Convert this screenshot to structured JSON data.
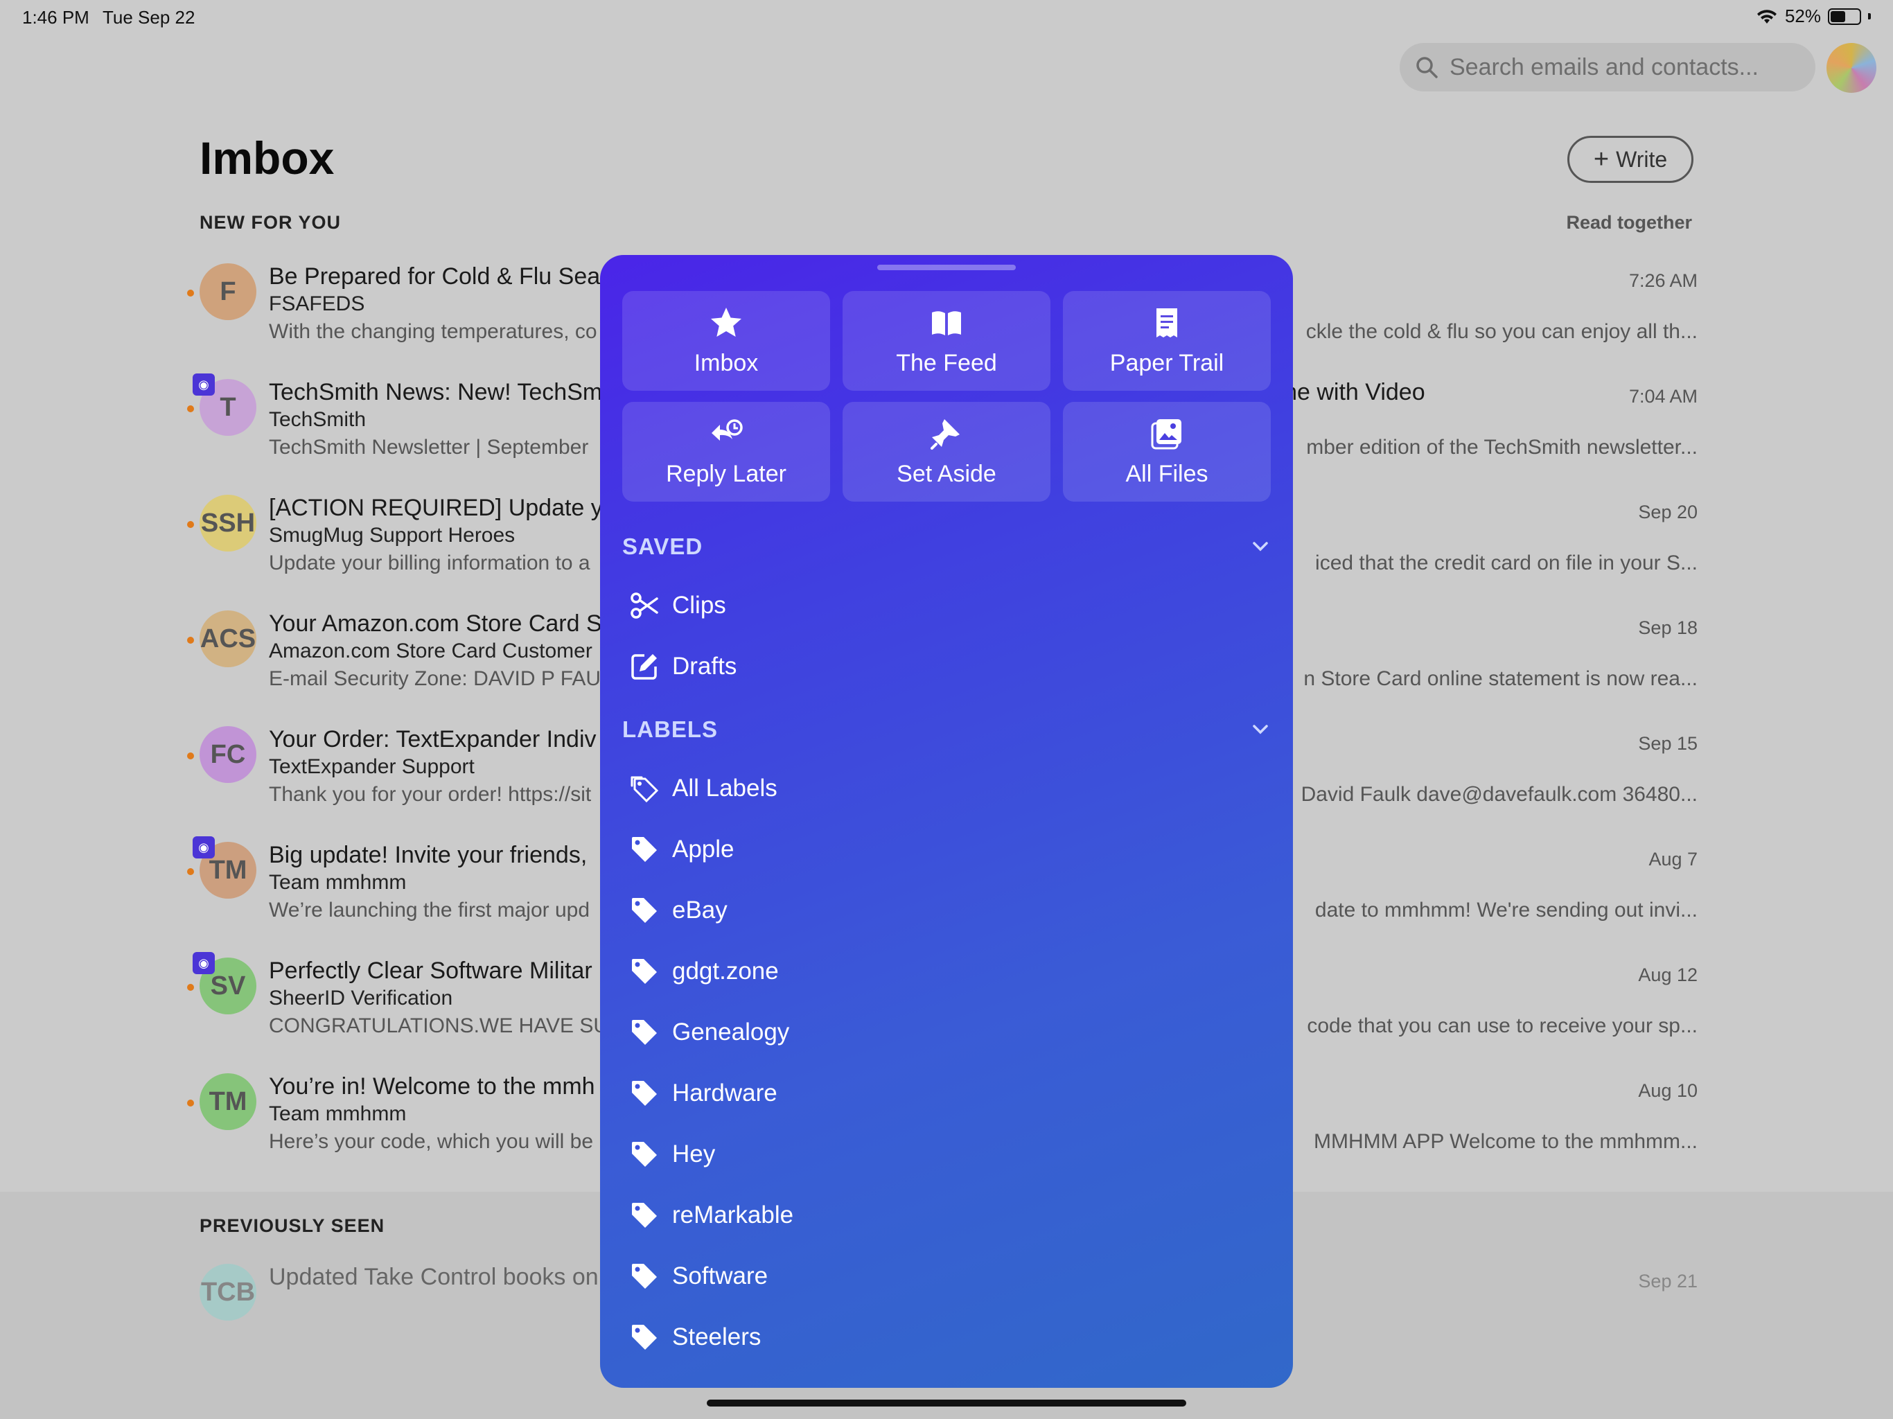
{
  "status": {
    "time": "1:46 PM",
    "date": "Tue Sep 22",
    "battery": "52%",
    "battery_level": 0.52
  },
  "search": {
    "placeholder": "Search emails and contacts..."
  },
  "page": {
    "title": "Imbox",
    "write_label": "Write",
    "section_new": "NEW FOR YOU",
    "read_together": "Read together",
    "section_prev": "PREVIOUSLY SEEN"
  },
  "emails": [
    {
      "initials": "F",
      "avatar_color": "#cfa27c",
      "subject": "Be Prepared for Cold & Flu Sea",
      "sender": "FSAFEDS",
      "snippet": "With the changing temperatures, co",
      "subject_right": "",
      "snippet_right": "ckle the cold & flu so you can enjoy all th...",
      "time": "7:26 AM",
      "badge": false
    },
    {
      "initials": "T",
      "avatar_color": "#c7a3d6",
      "subject": "TechSmith News: New! TechSm",
      "sender": "TechSmith",
      "snippet": "TechSmith Newsletter | September",
      "subject_right": "line with Video",
      "snippet_right": "mber edition of the TechSmith newsletter...",
      "time": "7:04 AM",
      "badge": true
    },
    {
      "initials": "SSH",
      "avatar_color": "#dccb78",
      "subject": "[ACTION REQUIRED] Update yo",
      "sender": "SmugMug Support Heroes",
      "snippet": "Update your billing information to a",
      "subject_right": "",
      "snippet_right": "iced that the credit card on file in your S...",
      "time": "Sep 20",
      "badge": false
    },
    {
      "initials": "ACS",
      "avatar_color": "#d1b283",
      "subject": "Your Amazon.com Store Card S",
      "sender": "Amazon.com Store Card Customer",
      "snippet": "E-mail Security Zone: DAVID P FAU",
      "subject_right": "",
      "snippet_right": "n Store Card online statement is now rea...",
      "time": "Sep 18",
      "badge": false
    },
    {
      "initials": "FC",
      "avatar_color": "#c194d6",
      "subject": "Your Order: TextExpander Indiv",
      "sender": "TextExpander Support",
      "snippet": "Thank you for your order! https://sit",
      "subject_right": "",
      "snippet_right": "David Faulk dave@davefaulk.com 36480...",
      "time": "Sep 15",
      "badge": false
    },
    {
      "initials": "TM",
      "avatar_color": "#cc9f7f",
      "subject": "Big update! Invite your friends,",
      "sender": "Team mmhmm",
      "snippet": "We’re launching the first major upd",
      "subject_right": "",
      "snippet_right": "date to mmhmm! We're sending out invi...",
      "time": "Aug 7",
      "badge": true
    },
    {
      "initials": "SV",
      "avatar_color": "#86c47a",
      "subject": "Perfectly Clear Software Militar",
      "sender": "SheerID Verification",
      "snippet": "CONGRATULATIONS.WE HAVE SUC",
      "subject_right": "",
      "snippet_right": "code that you can use to receive your sp...",
      "time": "Aug 12",
      "badge": true
    },
    {
      "initials": "TM",
      "avatar_color": "#86c47a",
      "subject": "You’re in! Welcome to the mmh",
      "sender": "Team mmhmm",
      "snippet": "Here’s your code, which you will be",
      "subject_right": "",
      "snippet_right": "MMHMM APP Welcome to the mmhmm...",
      "time": "Aug 10",
      "badge": false
    }
  ],
  "previous": {
    "initials": "TCB",
    "avatar_color": "#8fd0cc",
    "subject": "Updated Take Control books on",
    "time": "Sep 21"
  },
  "popover": {
    "tiles": [
      {
        "label": "Imbox",
        "icon": "star-icon"
      },
      {
        "label": "The Feed",
        "icon": "book-icon"
      },
      {
        "label": "Paper Trail",
        "icon": "receipt-icon"
      },
      {
        "label": "Reply Later",
        "icon": "reply-clock-icon"
      },
      {
        "label": "Set Aside",
        "icon": "pin-icon"
      },
      {
        "label": "All Files",
        "icon": "photos-icon"
      }
    ],
    "saved_header": "SAVED",
    "saved": [
      {
        "label": "Clips",
        "icon": "scissors-icon"
      },
      {
        "label": "Drafts",
        "icon": "pencil-square-icon"
      }
    ],
    "labels_header": "LABELS",
    "labels": [
      {
        "label": "All Labels",
        "icon": "tags-icon"
      },
      {
        "label": "Apple",
        "icon": "tag-icon"
      },
      {
        "label": "eBay",
        "icon": "tag-icon"
      },
      {
        "label": "gdgt.zone",
        "icon": "tag-icon"
      },
      {
        "label": "Genealogy",
        "icon": "tag-icon"
      },
      {
        "label": "Hardware",
        "icon": "tag-icon"
      },
      {
        "label": "Hey",
        "icon": "tag-icon"
      },
      {
        "label": "reMarkable",
        "icon": "tag-icon"
      },
      {
        "label": "Software",
        "icon": "tag-icon"
      },
      {
        "label": "Steelers",
        "icon": "tag-icon"
      }
    ]
  },
  "colors": {
    "popover_top": "#4a25e8",
    "popover_bottom": "#3168c9",
    "unread_dot": "#e07a1a",
    "badge": "#4b35d6"
  }
}
